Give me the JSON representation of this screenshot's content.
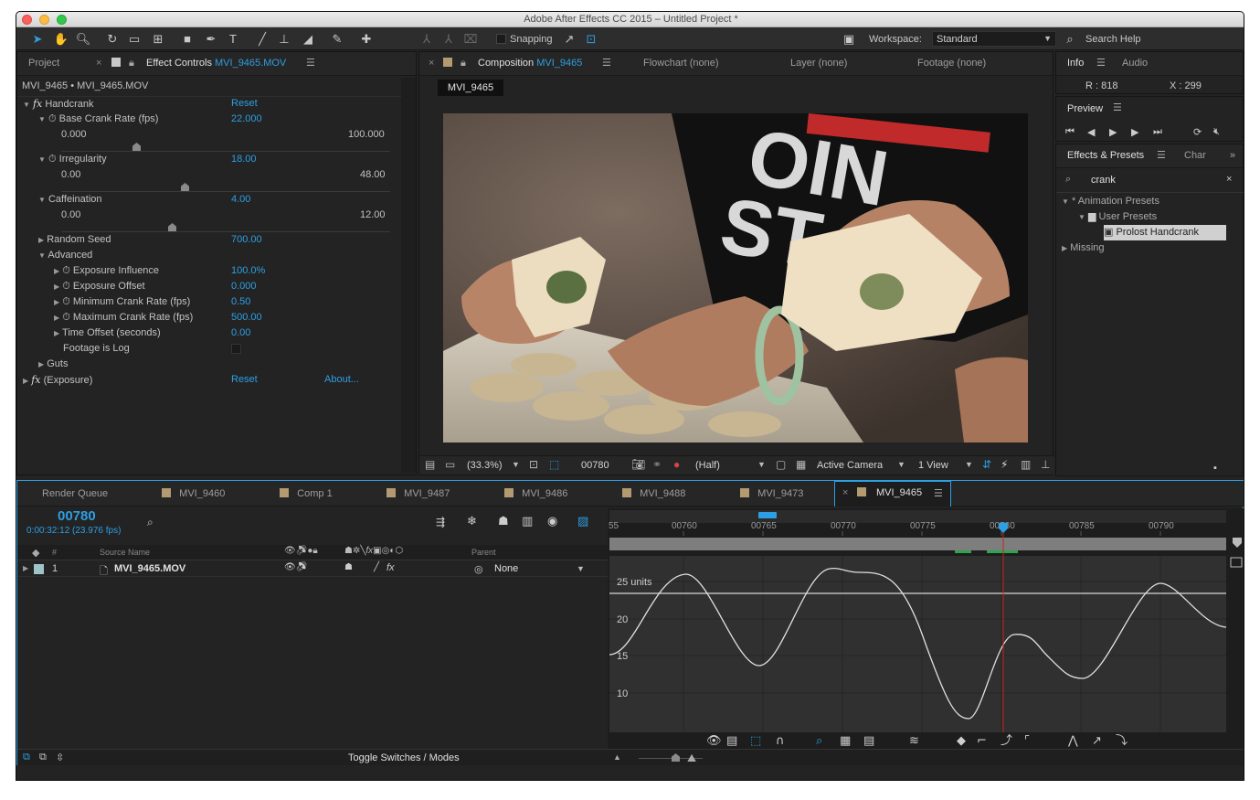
{
  "window": {
    "title": "Adobe After Effects CC 2015 – Untitled Project *"
  },
  "toolbar": {
    "snapping_label": "Snapping",
    "workspace_label": "Workspace:",
    "workspace_value": "Standard",
    "search_help": "Search Help"
  },
  "effect_controls": {
    "project_tab": "Project",
    "tab_prefix": "Effect Controls",
    "tab_clip": "MVI_9465.MOV",
    "header": "MVI_9465 • MVI_9465.MOV",
    "handcrank": {
      "name": "Handcrank",
      "reset": "Reset"
    },
    "base_crank": {
      "name": "Base Crank Rate (fps)",
      "value": "22.000",
      "min": "0.000",
      "max": "100.000"
    },
    "irregularity": {
      "name": "Irregularity",
      "value": "18.00",
      "min": "0.00",
      "max": "48.00"
    },
    "caffeination": {
      "name": "Caffeination",
      "value": "4.00",
      "min": "0.00",
      "max": "12.00"
    },
    "random_seed": {
      "name": "Random Seed",
      "value": "700.00"
    },
    "advanced": "Advanced",
    "exposure_influence": {
      "name": "Exposure Influence",
      "value": "100.0%"
    },
    "exposure_offset": {
      "name": "Exposure Offset",
      "value": "0.000"
    },
    "min_crank": {
      "name": "Minimum Crank Rate (fps)",
      "value": "0.50"
    },
    "max_crank": {
      "name": "Maximum Crank Rate (fps)",
      "value": "500.00"
    },
    "time_offset": {
      "name": "Time Offset (seconds)",
      "value": "0.00"
    },
    "footage_log": "Footage is Log",
    "guts": "Guts",
    "exposure": {
      "name": "(Exposure)",
      "reset": "Reset",
      "about": "About..."
    }
  },
  "composition": {
    "tab_prefix": "Composition",
    "tab_name": "MVI_9465",
    "flowchart": "Flowchart (none)",
    "layer": "Layer (none)",
    "footage": "Footage (none)",
    "subtab": "MVI_9465",
    "zoom": "(33.3%)",
    "timecode": "00780",
    "resolution": "(Half)",
    "camera": "Active Camera",
    "views": "1 View"
  },
  "info": {
    "tab_info": "Info",
    "tab_audio": "Audio",
    "r_label": "R : 818",
    "x_label": "X : 299",
    "preview_tab": "Preview"
  },
  "effects_presets": {
    "tab": "Effects & Presets",
    "tab2": "Char",
    "search_value": "crank",
    "tree": {
      "animation_presets": "* Animation Presets",
      "user_presets": "User Presets",
      "preset_item": "Prolost Handcrank",
      "missing": "Missing"
    }
  },
  "timeline": {
    "tabs": [
      "Render Queue",
      "MVI_9460",
      "Comp 1",
      "MVI_9487",
      "MVI_9486",
      "MVI_9488",
      "MVI_9473",
      "MVI_9465"
    ],
    "timecode": "00780",
    "timecode_sub": "0:00:32:12 (23.976 fps)",
    "col_num": "#",
    "col_source": "Source Name",
    "col_parent": "Parent",
    "layer": {
      "num": "1",
      "name": "MVI_9465.MOV",
      "parent": "None"
    },
    "ruler": [
      "55",
      "00760",
      "00765",
      "00770",
      "00775",
      "00780",
      "00785",
      "00790"
    ],
    "graph_labels": [
      "25 units",
      "20",
      "15",
      "10"
    ],
    "toggle_label": "Toggle Switches / Modes"
  },
  "colors": {
    "accent": "#2d9fe3",
    "playhead": "#d02020",
    "panel_bg": "#232323",
    "label_swatch": "#b49a70"
  }
}
